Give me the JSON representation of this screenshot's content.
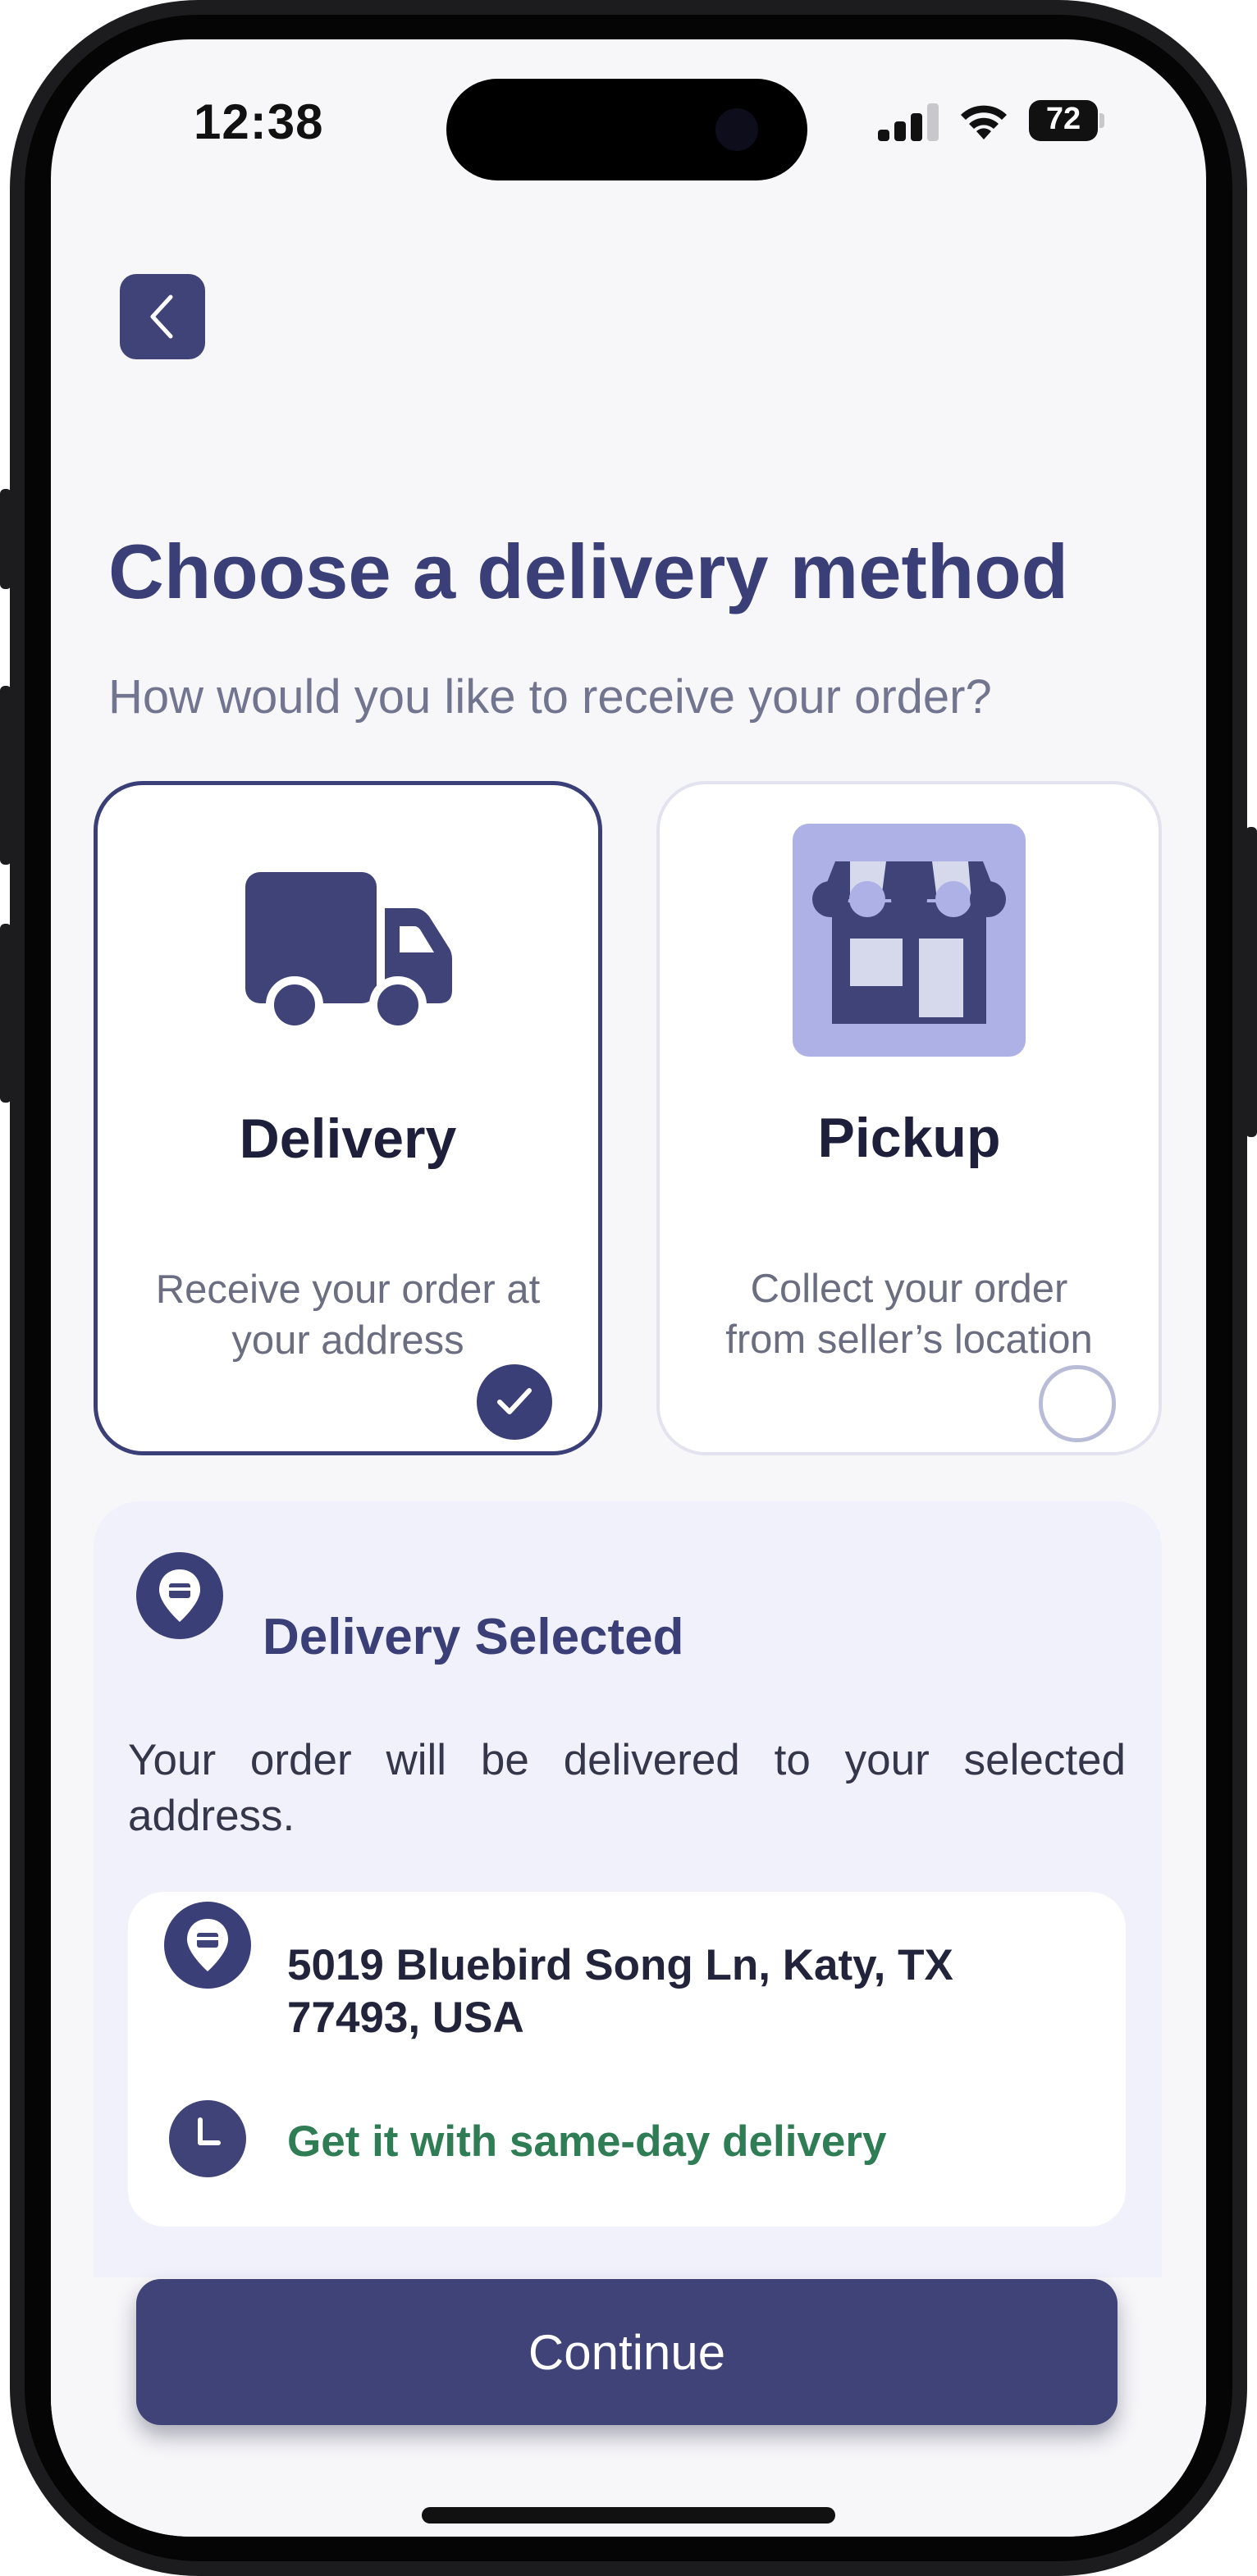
{
  "status_bar": {
    "time": "12:38",
    "battery": "72"
  },
  "header": {
    "back_icon": "chevron-left-icon",
    "title": "Choose a delivery method",
    "subtitle": "How would you like to receive your order?"
  },
  "options": [
    {
      "title": "Delivery",
      "description_line1": "Receive your order at",
      "description_line2": "your address",
      "icon": "truck-icon",
      "selected": true
    },
    {
      "title": "Pickup",
      "description_line1": "Collect your order",
      "description_line2": "from seller’s location",
      "icon": "storefront-icon",
      "selected": false
    }
  ],
  "info_panel": {
    "title": "Delivery Selected",
    "text": "Your order will be delivered to your selected address.",
    "address_line1": "5019 Bluebird Song Ln, Katy, TX",
    "address_line2": "77493, USA",
    "delivery_note": "Get it with same-day delivery"
  },
  "footer": {
    "continue_label": "Continue"
  },
  "colors": {
    "primary": "#3f4377",
    "accent_green": "#2f7d54",
    "panel_bg": "#f0f1fb",
    "store_bg": "#aeb1e6"
  }
}
